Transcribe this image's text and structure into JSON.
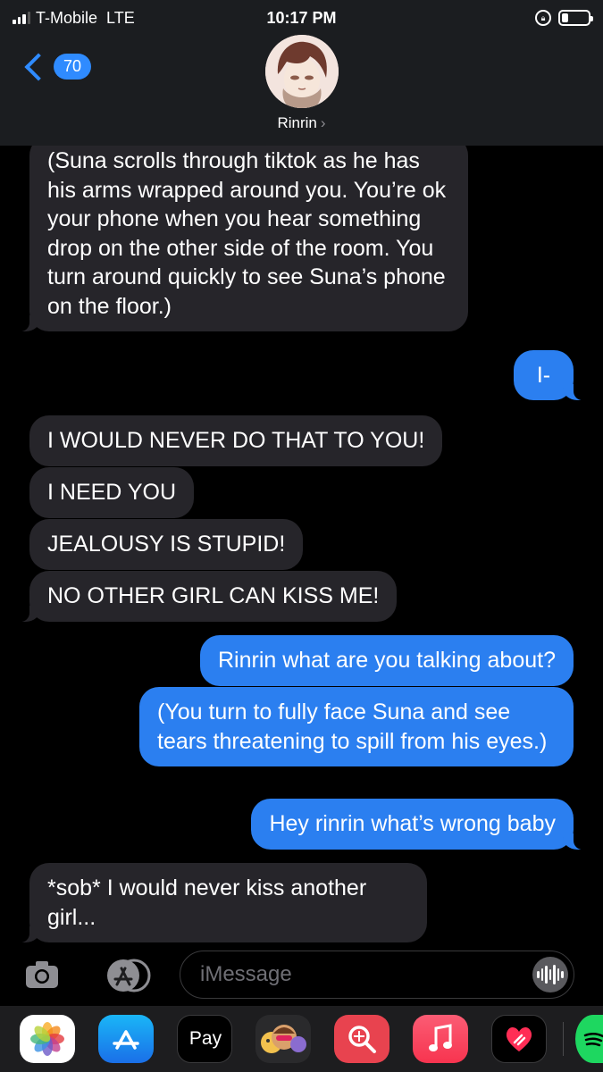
{
  "status_bar": {
    "carrier": "T-Mobile",
    "network": "LTE",
    "time": "10:17 PM",
    "battery_level": 0.25
  },
  "header": {
    "back_count": "70",
    "contact_name": "Rinrin",
    "chevron": "›"
  },
  "messages": [
    {
      "from": "contact",
      "text": "(Suna scrolls through tiktok as he has his arms wrapped around you. You’re ok your phone when you hear something drop on the other side of the room. You turn around quickly to see Suna’s phone on the floor.)"
    },
    {
      "from": "me",
      "text": "I-"
    },
    {
      "from": "contact",
      "text": "I WOULD NEVER DO THAT TO YOU!"
    },
    {
      "from": "contact",
      "text": "I NEED YOU"
    },
    {
      "from": "contact",
      "text": "JEALOUSY IS STUPID!"
    },
    {
      "from": "contact",
      "text": "NO OTHER GIRL CAN KISS ME!"
    },
    {
      "from": "me",
      "text": "Rinrin what are you talking about?"
    },
    {
      "from": "me",
      "text": "(You turn to fully face Suna and see tears threatening to spill from his eyes.)"
    },
    {
      "from": "me",
      "text": "Hey rinrin what’s wrong baby"
    },
    {
      "from": "contact",
      "text": "*sob* I would never kiss another girl..."
    }
  ],
  "input": {
    "placeholder": "iMessage"
  },
  "app_drawer": {
    "apps": [
      "Photos",
      "App Store",
      "Apple Pay",
      "Memoji",
      "Search Images",
      "Music",
      "Digital Touch",
      "Spotify"
    ],
    "apple_pay_label": "Pay",
    "apple_pay_logo": "",
    "icons": [
      "photos-icon",
      "app-store-icon",
      "apple-pay-icon",
      "memoji-icon",
      "image-search-icon",
      "music-icon",
      "digital-touch-icon",
      "spotify-icon"
    ]
  },
  "colors": {
    "incoming_bubble": "#26252a",
    "outgoing_bubble": "#2b7ff0",
    "accent": "#2f8bff",
    "header_bg": "#1b1d20"
  }
}
